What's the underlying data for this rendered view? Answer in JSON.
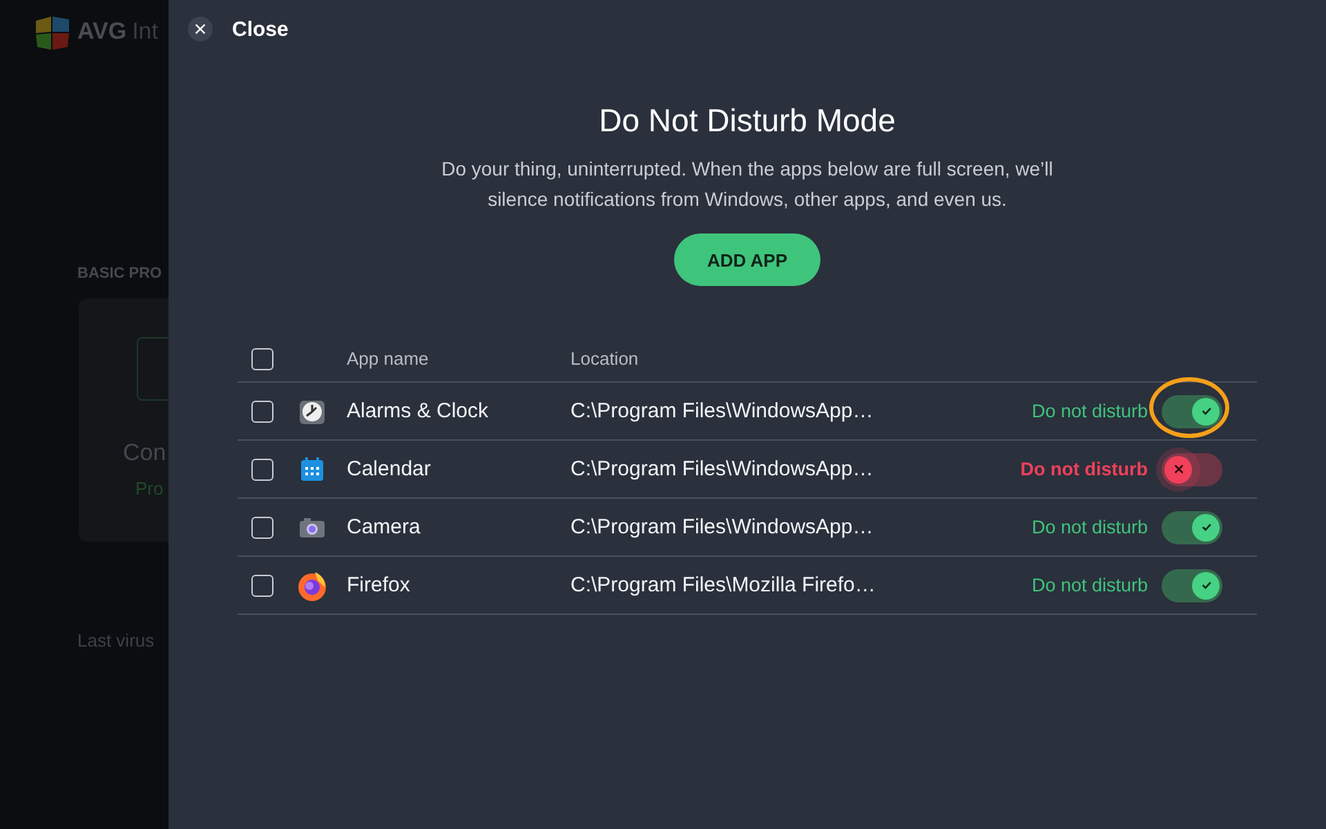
{
  "background": {
    "brand": "AVG",
    "product": "Int",
    "section_label": "BASIC PRO",
    "card_title": "Con",
    "card_status": "Pro",
    "footer": "Last virus"
  },
  "close": {
    "label": "Close"
  },
  "title": "Do Not Disturb Mode",
  "description": "Do your thing, uninterrupted. When the apps below are full screen, we’ll silence notifications from Windows, other apps, and even us.",
  "add_button": "ADD APP",
  "table": {
    "select_all_checked": false,
    "columns": [
      "App name",
      "Location"
    ],
    "rows": [
      {
        "checked": false,
        "kind": "clock",
        "name": "Alarms & Clock",
        "location": "C:\\Program Files\\WindowsApp…",
        "status": "Do not disturb",
        "on": true,
        "highlighted": true
      },
      {
        "checked": false,
        "kind": "calendar",
        "name": "Calendar",
        "location": "C:\\Program Files\\WindowsApp…",
        "status": "Do not disturb",
        "on": false,
        "highlighted": false
      },
      {
        "checked": false,
        "kind": "camera",
        "name": "Camera",
        "location": "C:\\Program Files\\WindowsApp…",
        "status": "Do not disturb",
        "on": true,
        "highlighted": false
      },
      {
        "checked": false,
        "kind": "firefox",
        "name": "Firefox",
        "location": "C:\\Program Files\\Mozilla Firefo…",
        "status": "Do not disturb",
        "on": true,
        "highlighted": false
      }
    ]
  }
}
